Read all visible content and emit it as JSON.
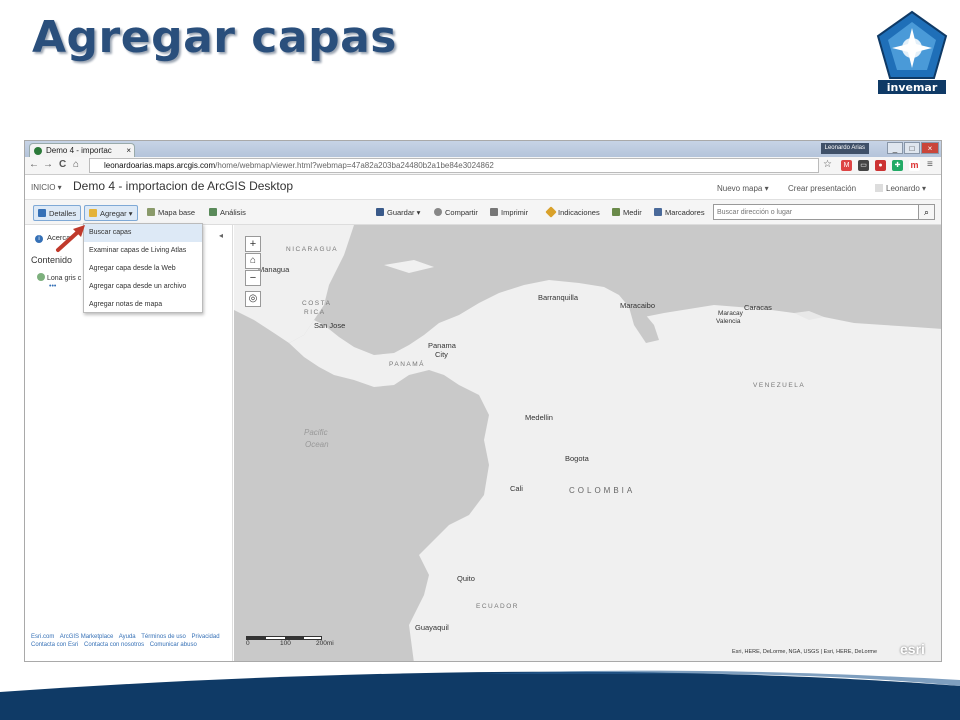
{
  "slide": {
    "title": "Agregar capas",
    "logo_text": "invemar"
  },
  "browser": {
    "tab_title": "Demo 4 - importac",
    "tab_close": "×",
    "user_badge": "Leonardo Arias",
    "window_buttons": [
      "_",
      "□",
      "×"
    ],
    "nav": {
      "back": "←",
      "forward": "→",
      "reload": "C",
      "home": "⌂"
    },
    "url_host": "leonardoarias.maps.arcgis.com",
    "url_path": "/home/webmap/viewer.html?webmap=47a82a203ba24480b2a1be84e3024862",
    "star": "☆",
    "menu": "≡"
  },
  "app": {
    "inicio": "INICIO ▾",
    "map_title": "Demo 4 - importacion de ArcGIS Desktop",
    "nuevo_mapa": "Nuevo mapa ▾",
    "crear_presentacion": "Crear presentación",
    "user": "Leonardo ▾"
  },
  "toolbar": {
    "detalles": "Detalles",
    "agregar": "Agregar ▾",
    "mapa_base": "Mapa base",
    "analisis": "Análisis",
    "guardar": "Guardar ▾",
    "compartir": "Compartir",
    "imprimir": "Imprimir",
    "indicaciones": "Indicaciones",
    "medir": "Medir",
    "marcadores": "Marcadores",
    "search_placeholder": "Buscar dirección o lugar",
    "search_icon": "⌕"
  },
  "left_panel": {
    "acerca": "Acerca",
    "collapse": "◂",
    "contenido": "Contenido",
    "layer": "Lona gris c",
    "dots": "•••",
    "footer": [
      "Esri.com",
      "ArcGIS Marketplace",
      "Ayuda",
      "Términos de uso",
      "Privacidad",
      "Contacta con Esri",
      "Contacta con nosotros",
      "Comunicar abuso"
    ]
  },
  "dropdown": {
    "items": [
      "Buscar capas",
      "Examinar capas de Living Atlas",
      "Agregar capa desde la Web",
      "Agregar capa desde un archivo",
      "Agregar notas de mapa"
    ]
  },
  "map": {
    "controls": {
      "zoom_in": "+",
      "home": "⌂",
      "zoom_out": "−",
      "locate": "◎"
    },
    "labels": {
      "nicaragua": "NICARAGUA",
      "managua": "Managua",
      "costa_rica_1": "COSTA",
      "costa_rica_2": "RICA",
      "san_jose": "San Jose",
      "panama": "PANAMÁ",
      "panama_city_1": "Panama",
      "panama_city_2": "City",
      "barranquilla": "Barranquilla",
      "maracaibo": "Maracaibo",
      "caracas": "Caracas",
      "maracay": "Maracay",
      "valencia": "Valencia",
      "venezuela": "VENEZUELA",
      "pacific_1": "Pacific",
      "pacific_2": "Ocean",
      "medellin": "Medellin",
      "bogota": "Bogota",
      "cali": "Cali",
      "colombia": "COLOMBIA",
      "quito": "Quito",
      "ecuador": "ECUADOR",
      "guayaquil": "Guayaquil"
    },
    "scale": [
      "0",
      "100",
      "200mi"
    ],
    "attribution": "Esri, HERE, DeLorme, NGA, USGS | Esri, HERE, DeLorme",
    "esri_logo": "esri"
  },
  "colors": {
    "title": "#2a4f7c",
    "wave_dark": "#0f3a66",
    "land": "#f0f0f0",
    "water": "#c9c9c9",
    "accent": "#3570b6"
  }
}
